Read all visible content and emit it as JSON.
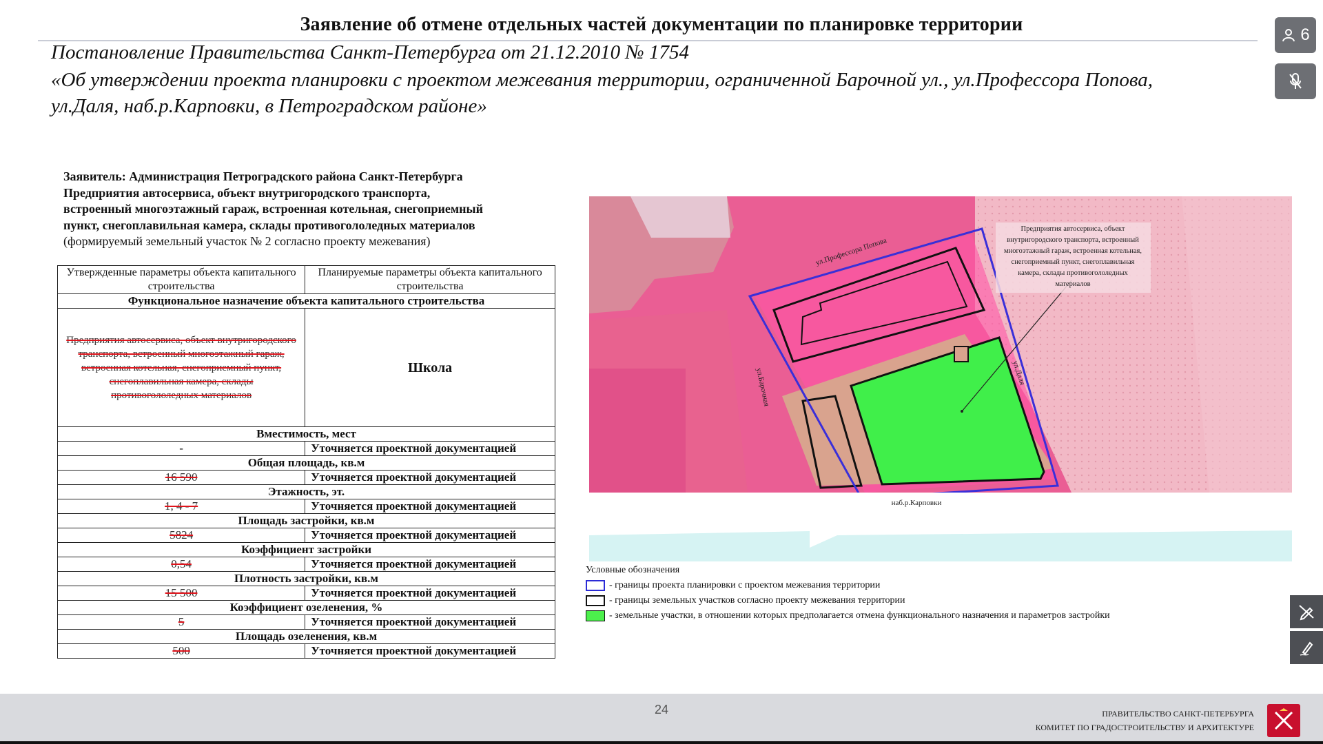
{
  "slide": {
    "title": "Заявление об отмене отдельных частей документации по планировке территории",
    "subtitle_line1": "Постановление Правительства Санкт-Петербурга от 21.12.2010 № 1754",
    "subtitle_line2": "«Об утверждении проекта планировки с проектом межевания территории, ограниченной Барочной ул., ул.Профессора Попова,",
    "subtitle_line3": "ул.Даля, наб.р.Карповки, в Петроградском районе»",
    "page_number": "24"
  },
  "applicant": {
    "line1": "Заявитель: Администрация Петроградского района Санкт-Петербурга",
    "line2": "Предприятия автосервиса, объект внутригородского транспорта,",
    "line3": "встроенный многоэтажный гараж, встроенная котельная, снегоприемный",
    "line4": "пункт, снегоплавильная камера, склады противогололедных материалов",
    "line5": "(формируемый земельный участок № 2 согласно проекту межевания)"
  },
  "table": {
    "col1_header": "Утвержденные параметры объекта капитального строительства",
    "col2_header": "Планируемые параметры объекта капитального строительства",
    "func_header": "Функциональное назначение объекта капитального строительства",
    "old_use": "Предприятия автосервиса, объект внутригородского транспорта, встроенный многоэтажный гараж, встроенная котельная, снегоприемный пункт, снегоплавильная камера, склады противогололедных материалов",
    "new_use": "Школа",
    "clarify": "Уточняется проектной документацией",
    "rows": [
      {
        "label": "Вместимость, мест",
        "old": "-",
        "struck": false
      },
      {
        "label": "Общая площадь, кв.м",
        "old": "16 590",
        "struck": true
      },
      {
        "label": "Этажность, эт.",
        "old": "1, 4 - 7",
        "struck": true
      },
      {
        "label": "Площадь застройки, кв.м",
        "old": "5824",
        "struck": true
      },
      {
        "label": "Коэффициент застройки",
        "old": "0,54",
        "struck": true
      },
      {
        "label": "Плотность застройки, кв.м",
        "old": "15 500",
        "struck": true
      },
      {
        "label": "Коэффициент озеленения, %",
        "old": "5",
        "struck": true
      },
      {
        "label": "Площадь озеленения, кв.м",
        "old": "500",
        "struck": true
      }
    ]
  },
  "map": {
    "street_top": "ул.Профессора Попова",
    "street_right": "ул.Даля",
    "street_left": "ул.Барочная",
    "embankment": "наб.р.Карповки",
    "callout": [
      "Предприятия автосервиса, объект",
      "внутригородского транспорта, встроенный",
      "многоэтажный гараж, встроенная котельная,",
      "снегоприемный пункт, снегоплавильная",
      "камера, склады противогололедных",
      "материалов"
    ]
  },
  "legend": {
    "title": "Условные обозначения",
    "item1": "- границы проекта планировки с проектом межевания территории",
    "item2": "- границы земельных участков согласно проекту межевания территории",
    "item3": "- земельные участки, в отношении которых предполагается отмена функционального назначения и параметров застройки",
    "colors": {
      "boundary": "#2b2bd6",
      "parcel": "#111111",
      "cancel": "#4cf04c"
    }
  },
  "footer": {
    "line1": "ПРАВИТЕЛЬСТВО САНКТ-ПЕТЕРБУРГА",
    "line2": "КОМИТЕТ ПО ГРАДОСТРОИТЕЛЬСТВУ И АРХИТЕКТУРЕ"
  },
  "controls": {
    "participants_count": "6",
    "participants_icon": "person-icon",
    "mic_icon": "mic-off-icon",
    "pen_icon": "pen-off-icon",
    "draw_icon": "draw-icon"
  }
}
